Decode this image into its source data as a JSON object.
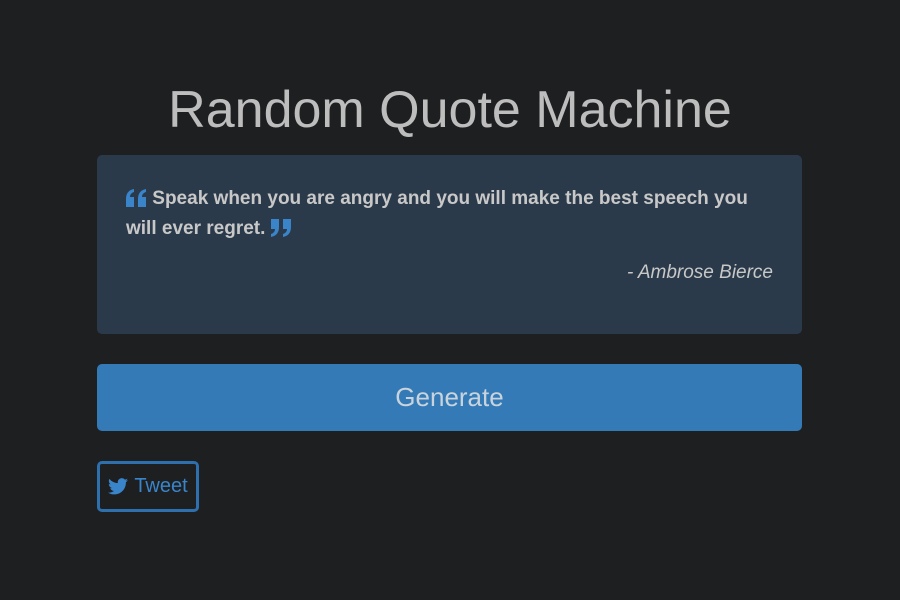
{
  "app": {
    "title": "Random Quote Machine"
  },
  "quote": {
    "text": "Speak when you are angry and you will make the best speech you will ever regret.",
    "author": "- Ambrose Bierce",
    "open_icon": "quote-left-icon",
    "close_icon": "quote-right-icon"
  },
  "actions": {
    "generate_label": "Generate",
    "tweet_label": "Tweet",
    "tweet_icon": "twitter-icon"
  },
  "colors": {
    "background": "#1e1f21",
    "card": "#2b3a4a",
    "accent": "#337ab7",
    "text": "#c8c8c8"
  }
}
